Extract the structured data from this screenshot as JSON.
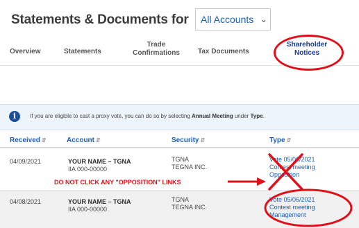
{
  "header": {
    "title": "Statements & Documents for",
    "account_select": "All Accounts"
  },
  "tabs": [
    {
      "line1": "Overview",
      "line2": ""
    },
    {
      "line1": "Statements",
      "line2": ""
    },
    {
      "line1": "Trade",
      "line2": "Confirmations"
    },
    {
      "line1": "Tax Documents",
      "line2": ""
    },
    {
      "line1": "Shareholder",
      "line2": "Notices"
    }
  ],
  "banner": {
    "text_before": "If you are eligible to cast a proxy vote, you can do so by selecting ",
    "bold1": "Annual Meeting",
    "text_mid": " under ",
    "bold2": "Type",
    "text_after": "."
  },
  "table": {
    "headers": {
      "received": "Received",
      "account": "Account",
      "security": "Security",
      "type": "Type"
    },
    "rows": [
      {
        "received": "04/09/2021",
        "account_name": "YOUR NAME – TGNA",
        "account_number": "IIA 000-00000",
        "security_ticker": "TGNA",
        "security_name": "TEGNA INC.",
        "type_line1": "Vote 05/06/2021",
        "type_line2": "Contest meeting",
        "type_line3": "Opposition"
      },
      {
        "received": "04/08/2021",
        "account_name": "YOUR NAME – TGNA",
        "account_number": "IIA 000-00000",
        "security_ticker": "TGNA",
        "security_name": "TEGNA INC.",
        "type_line1": "Vote 05/06/2021",
        "type_line2": "Contest meeting",
        "type_line3": "Management"
      }
    ]
  },
  "annotation": {
    "warning": "DO NOT CLICK ANY \"OPPOSITION\" LINKS"
  },
  "colors": {
    "annotation_red": "#e0101a",
    "link_blue": "#1a5fb4",
    "info_navy": "#1e4f9c"
  }
}
